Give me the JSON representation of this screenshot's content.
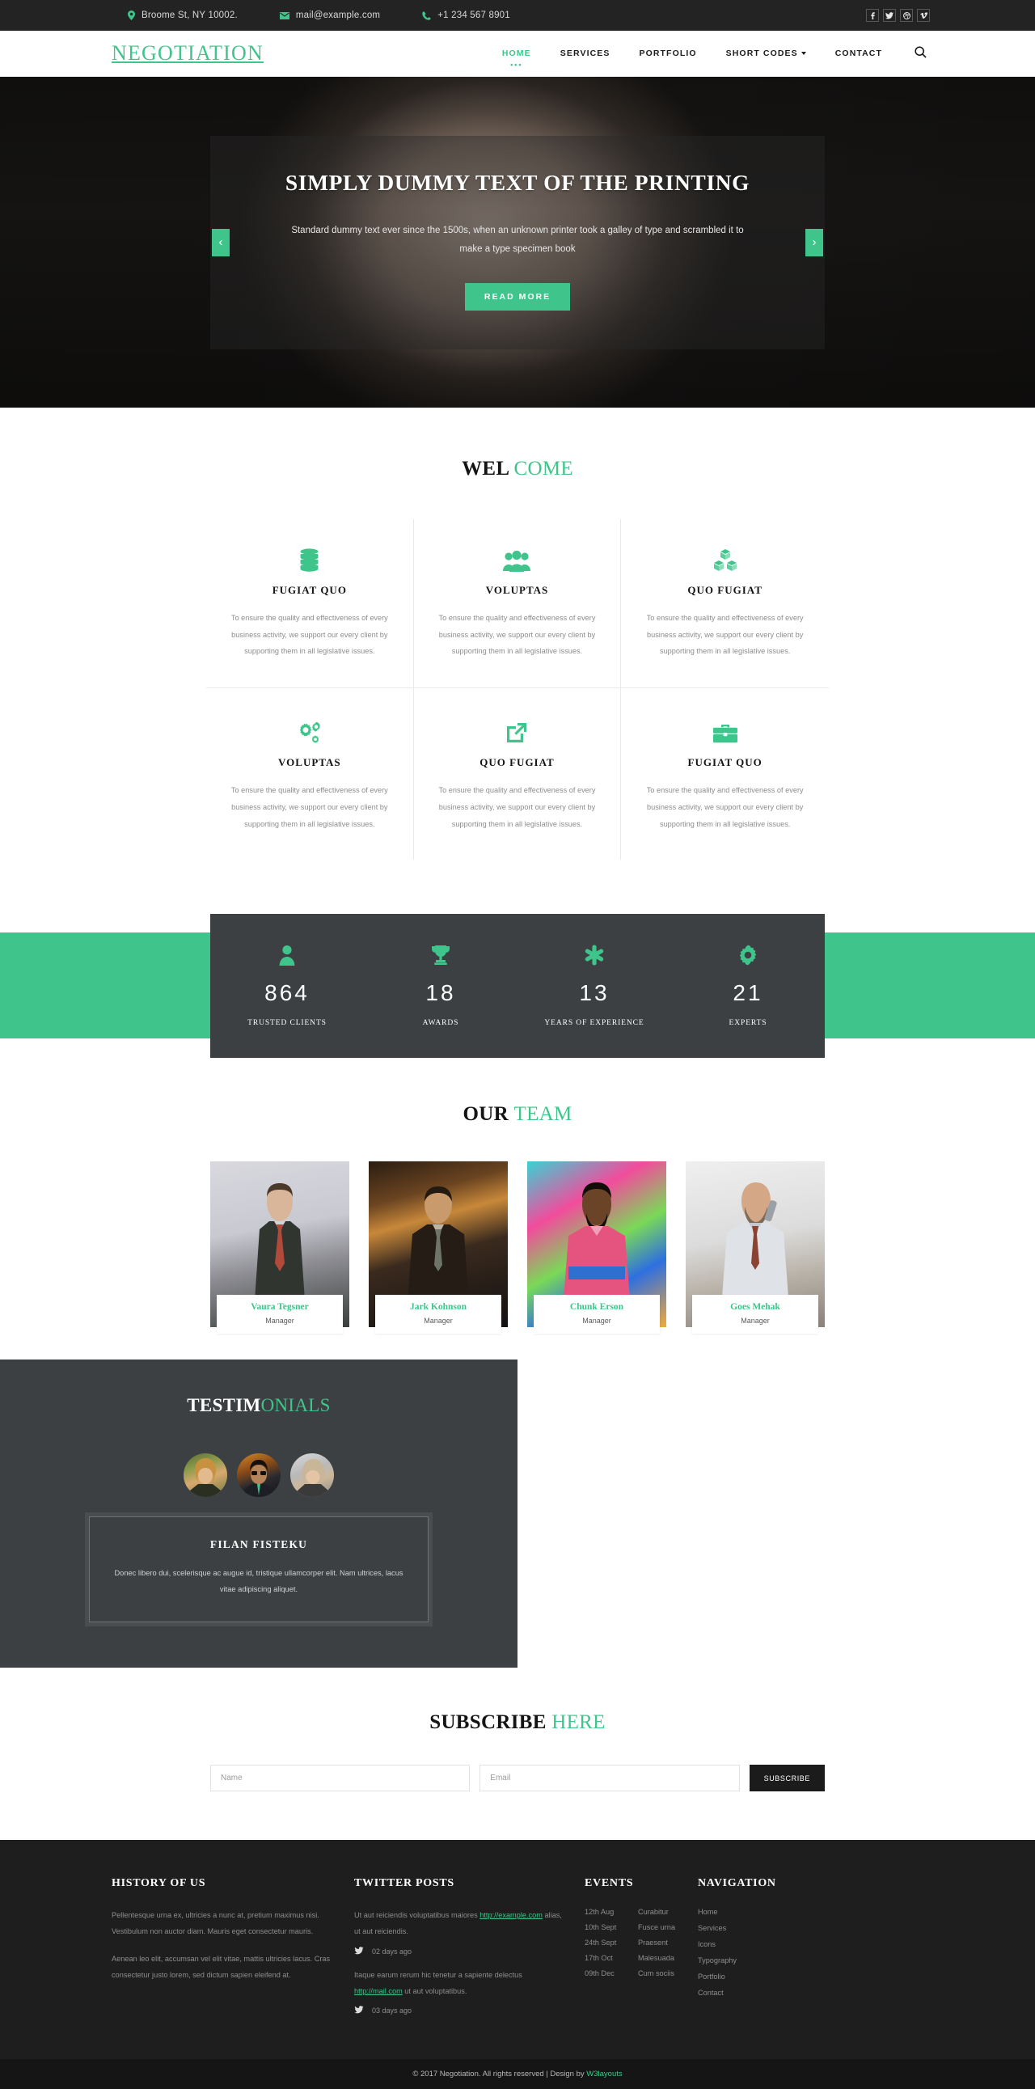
{
  "topbar": {
    "address": "Broome St, NY 10002.",
    "email": "mail@example.com",
    "phone": "+1 234 567 8901",
    "social": [
      "facebook-icon",
      "twitter-icon",
      "dribbble-icon",
      "vimeo-icon"
    ]
  },
  "header": {
    "logo": "NEGOTIATION",
    "nav": [
      {
        "label": "HOME",
        "active": true
      },
      {
        "label": "SERVICES",
        "active": false
      },
      {
        "label": "PORTFOLIO",
        "active": false
      },
      {
        "label": "SHORT CODES",
        "active": false,
        "caret": true
      },
      {
        "label": "CONTACT",
        "active": false
      }
    ],
    "search_icon": "search-icon"
  },
  "banner": {
    "title": "SIMPLY DUMMY TEXT OF THE PRINTING",
    "text": "Standard dummy text ever since the 1500s, when an unknown printer took a galley of type and scrambled it to make a type specimen book",
    "button": "READ MORE",
    "prev": "‹",
    "next": "›"
  },
  "welcome": {
    "title_bold": "WEL",
    "title_light": "COME",
    "items": [
      {
        "icon": "database-icon",
        "title": "FUGIAT QUO",
        "text": "To ensure the quality and effectiveness of every business activity, we support our every client by supporting them in all legislative issues."
      },
      {
        "icon": "group-icon",
        "title": "VOLUPTAS",
        "text": "To ensure the quality and effectiveness of every business activity, we support our every client by supporting them in all legislative issues."
      },
      {
        "icon": "cubes-icon",
        "title": "QUO FUGIAT",
        "text": "To ensure the quality and effectiveness of every business activity, we support our every client by supporting them in all legislative issues."
      },
      {
        "icon": "cogs-icon",
        "title": "VOLUPTAS",
        "text": "To ensure the quality and effectiveness of every business activity, we support our every client by supporting them in all legislative issues."
      },
      {
        "icon": "external-link-icon",
        "title": "QUO FUGIAT",
        "text": "To ensure the quality and effectiveness of every business activity, we support our every client by supporting them in all legislative issues."
      },
      {
        "icon": "briefcase-icon",
        "title": "FUGIAT QUO",
        "text": "To ensure the quality and effectiveness of every business activity, we support our every client by supporting them in all legislative issues."
      }
    ]
  },
  "stats": [
    {
      "icon": "user-icon",
      "number": "864",
      "label": "TRUSTED CLIENTS"
    },
    {
      "icon": "trophy-icon",
      "number": "18",
      "label": "AWARDS"
    },
    {
      "icon": "asterisk-icon",
      "number": "13",
      "label": "YEARS OF EXPERIENCE"
    },
    {
      "icon": "gear-icon",
      "number": "21",
      "label": "EXPERTS"
    }
  ],
  "team": {
    "title_bold": "OUR",
    "title_light": "TEAM",
    "members": [
      {
        "name": "Vaura Tegsner",
        "role": "Manager"
      },
      {
        "name": "Jark Kohnson",
        "role": "Manager"
      },
      {
        "name": "Chunk Erson",
        "role": "Manager"
      },
      {
        "name": "Goes Mehak",
        "role": "Manager"
      }
    ]
  },
  "testimonials": {
    "title_bold": "TESTIM",
    "title_light": "ONIALS",
    "avatars": [
      "avatar-1",
      "avatar-2",
      "avatar-3"
    ],
    "quote_name": "FILAN FISTEKU",
    "quote_text": "Donec libero dui, scelerisque ac augue id, tristique ullamcorper elit. Nam ultrices, lacus vitae adipiscing aliquet."
  },
  "subscribe": {
    "title_bold": "SUBSCRIBE",
    "title_light": "HERE",
    "name_placeholder": "Name",
    "email_placeholder": "Email",
    "button": "SUBSCRIBE"
  },
  "footer": {
    "history": {
      "title": "HISTORY OF US",
      "p1": "Pellentesque urna ex, ultricies a nunc at, pretium maximus nisi. Vestibulum non auctor diam. Mauris eget consectetur mauris.",
      "p2": "Aenean leo elit, accumsan vel elit vitae, mattis ultricies lacus. Cras consectetur justo lorem, sed dictum sapien eleifend at."
    },
    "twitter": {
      "title": "TWITTER POSTS",
      "posts": [
        {
          "pre": "Ut aut reiciendis voluptatibus maiores",
          "link": "http://example.com",
          "post": " alias, ut aut reiciendis.",
          "time": "02 days ago"
        },
        {
          "pre": "Itaque earum rerum hic tenetur a sapiente delectus",
          "link": "http://mail.com",
          "post": " ut aut voluptatibus.",
          "time": "03 days ago"
        }
      ]
    },
    "events": {
      "title": "EVENTS",
      "rows": [
        {
          "date": "12th Aug",
          "name": "Curabitur"
        },
        {
          "date": "10th Sept",
          "name": "Fusce urna"
        },
        {
          "date": "24th Sept",
          "name": "Praesent"
        },
        {
          "date": "17th Oct",
          "name": "Malesuada"
        },
        {
          "date": "09th Dec",
          "name": "Cum sociis"
        }
      ]
    },
    "navigation": {
      "title": "NAVIGATION",
      "links": [
        "Home",
        "Services",
        "Icons",
        "Typography",
        "Portfolio",
        "Contact"
      ]
    },
    "copyright_pre": "© 2017 Negotiation. All rights reserved | Design by ",
    "copyright_link": "W3layouts"
  },
  "colors": {
    "accent": "#3fc58b",
    "dark": "#3c4043",
    "topbar": "#232323",
    "footer": "#1e1e1e"
  }
}
